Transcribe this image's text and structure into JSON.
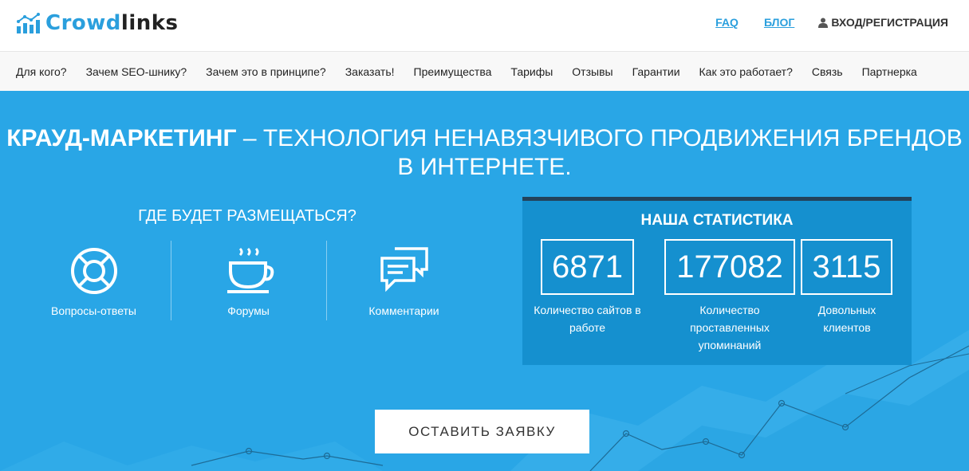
{
  "brand": {
    "part1": "Crowd",
    "part2": "links",
    "accent": "#2a9fdd"
  },
  "toplinks": {
    "faq": "FAQ",
    "blog": "БЛОГ",
    "login": "ВХОД/РЕГИСТРАЦИЯ"
  },
  "nav": [
    "Для кого?",
    "Зачем SEO-шнику?",
    "Зачем это в принципе?",
    "Заказать!",
    "Преимущества",
    "Тарифы",
    "Отзывы",
    "Гарантии",
    "Как это работает?",
    "Связь",
    "Партнерка"
  ],
  "hero": {
    "headline_bold": "КРАУД-МАРКЕТИНГ",
    "headline_rest": " – ТЕХНОЛОГИЯ НЕНАВЯЗЧИВОГО ПРОДВИЖЕНИЯ БРЕНДОВ В ИНТЕРНЕТЕ.",
    "bg_color": "#29a6e6"
  },
  "placement": {
    "title": "ГДЕ БУДЕТ РАЗМЕЩАТЬСЯ?",
    "items": [
      {
        "label": "Вопросы-ответы",
        "icon": "lifebuoy-icon"
      },
      {
        "label": "Форумы",
        "icon": "coffee-cup-icon"
      },
      {
        "label": "Комментарии",
        "icon": "chat-bubbles-icon"
      }
    ]
  },
  "stats": {
    "title": "НАША СТАТИСТИКА",
    "items": [
      {
        "value": "6871",
        "label": "Количество сайтов в работе"
      },
      {
        "value": "177082",
        "label": "Количество проставленных упоминаний"
      },
      {
        "value": "3115",
        "label": "Довольных клиентов"
      }
    ]
  },
  "cta": {
    "label": "ОСТАВИТЬ ЗАЯВКУ"
  }
}
